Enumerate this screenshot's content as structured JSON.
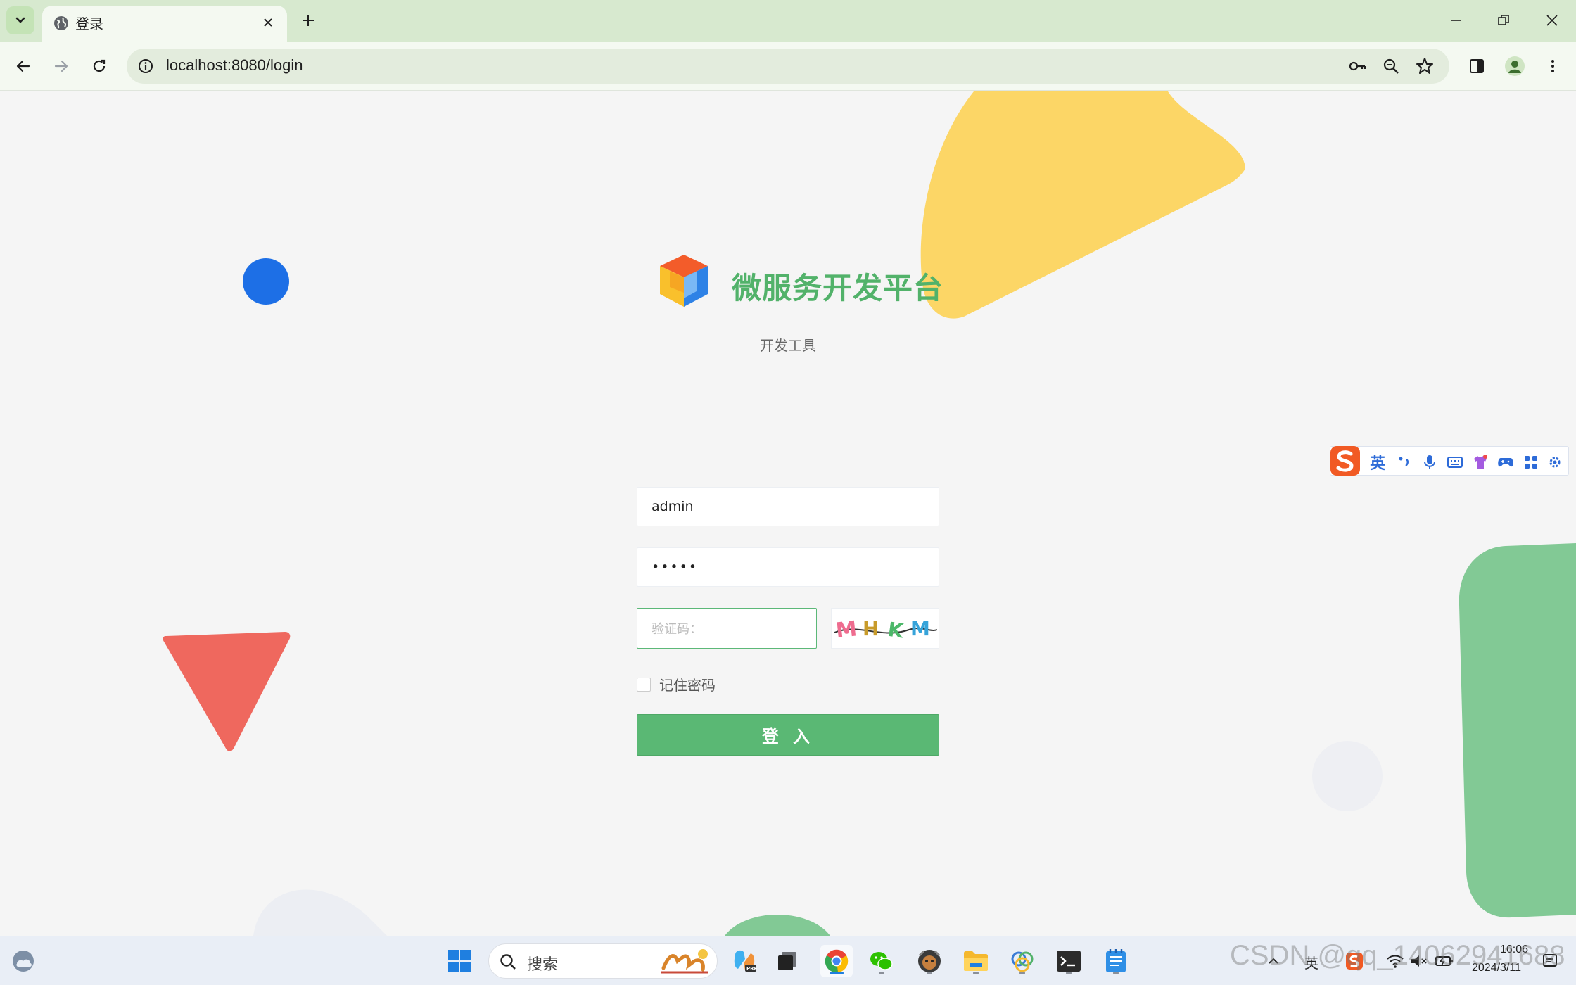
{
  "browser": {
    "tab_title": "登录",
    "url": "localhost:8080/login"
  },
  "page": {
    "brand_name": "微服务开发平台",
    "subtitle": "开发工具",
    "username_value": "admin",
    "password_value": "•••••",
    "captcha_placeholder": "验证码：",
    "captcha_code": "MHKM",
    "remember_label": "记住密码",
    "login_button": "登 入"
  },
  "ime": {
    "mode": "英"
  },
  "taskbar": {
    "search_label": "搜索",
    "lang": "英",
    "time": "16:06",
    "date": "2024/3/11"
  },
  "watermark": "CSDN @qq_14062941688",
  "colors": {
    "brand_green": "#52b26a",
    "button_green": "#5ab874",
    "deco_yellow": "#fcd666",
    "deco_blue": "#1d6fe6",
    "deco_red": "#ef685e",
    "deco_green": "#82c995"
  }
}
